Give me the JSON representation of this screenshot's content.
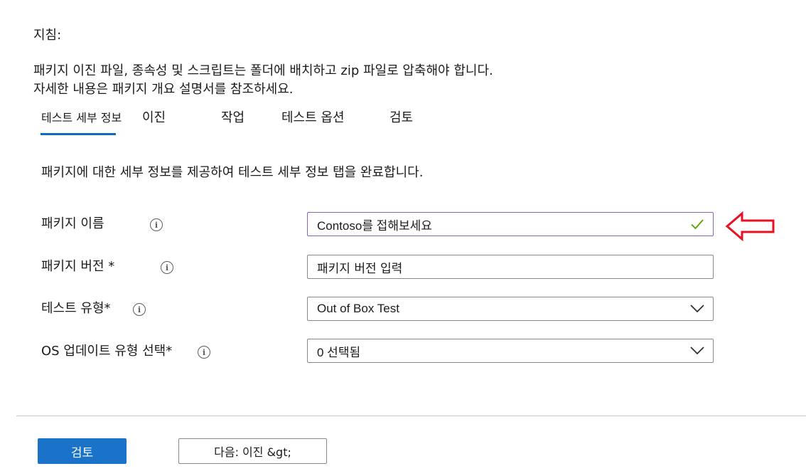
{
  "guidance": {
    "heading": "지침:",
    "line1": "패키지 이진 파일, 종속성 및 스크립트는 폴더에 배치하고 zip 파일로 압축해야 합니다.",
    "line2": "자세한 내용은 패키지 개요 설명서를 참조하세요."
  },
  "tabs": [
    {
      "label": "테스트 세부 정보",
      "active": true
    },
    {
      "label": "이진"
    },
    {
      "label": "작업"
    },
    {
      "label": "테스트 옵션"
    },
    {
      "label": "검토"
    }
  ],
  "description": "패키지에 대한 세부 정보를 제공하여 테스트 세부 정보 탭을 완료합니다.",
  "form": {
    "package_name": {
      "label": "패키지 이름",
      "value": "Contoso를 접해보세요",
      "status_icon": "checkmark-icon",
      "icon_color": "#57a300"
    },
    "package_version": {
      "label": "패키지 버전 *",
      "placeholder": "패키지 버전 입력"
    },
    "test_type": {
      "label": "테스트 유형*",
      "value": "Out of Box Test"
    },
    "os_update_type": {
      "label": "OS 업데이트 유형 선택*",
      "value": "0 선택됨"
    }
  },
  "annotation": {
    "icon": "left-arrow-icon",
    "color": "#e81123"
  },
  "buttons": {
    "review": "검토",
    "next": "다음: 이진 &gt;"
  },
  "colors": {
    "accent": "#0f6cbd",
    "primary_button": "#1a73c9",
    "focus_border": "#8764b8"
  }
}
